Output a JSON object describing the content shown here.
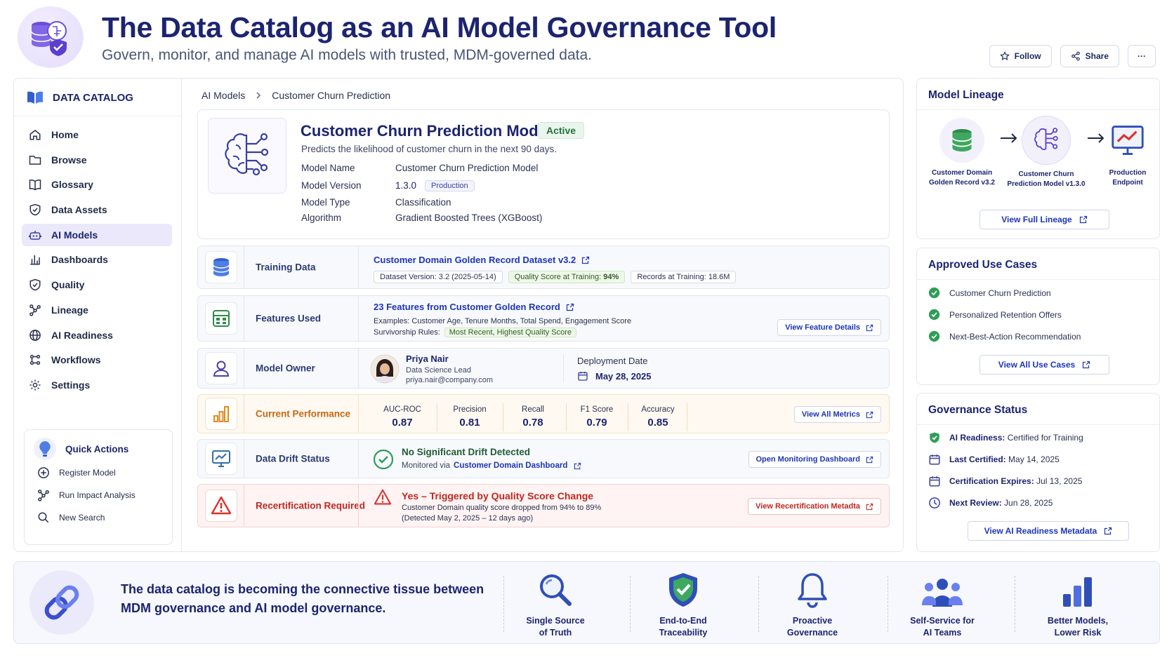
{
  "header": {
    "title": "The Data Catalog as an AI Model Governance Tool",
    "subtitle": "Govern, monitor, and manage AI models with trusted, MDM-governed data.",
    "follow_label": "Follow",
    "share_label": "Share",
    "more_label": "···"
  },
  "sidebar": {
    "brand": "DATA CATALOG",
    "items": [
      {
        "label": "Home",
        "icon": "home-icon"
      },
      {
        "label": "Browse",
        "icon": "folder-icon"
      },
      {
        "label": "Glossary",
        "icon": "book-icon"
      },
      {
        "label": "Data Assets",
        "icon": "shield-icon"
      },
      {
        "label": "AI Models",
        "icon": "robot-icon"
      },
      {
        "label": "Dashboards",
        "icon": "bar-chart-icon"
      },
      {
        "label": "Quality",
        "icon": "shield-check-icon"
      },
      {
        "label": "Lineage",
        "icon": "network-icon"
      },
      {
        "label": "AI Readiness",
        "icon": "globe-icon"
      },
      {
        "label": "Workflows",
        "icon": "workflow-icon"
      },
      {
        "label": "Settings",
        "icon": "gear-icon"
      }
    ],
    "active_index": 4,
    "quick_actions": {
      "title": "Quick Actions",
      "items": [
        "Register Model",
        "Run Impact Analysis",
        "New Search"
      ]
    }
  },
  "breadcrumb": [
    "AI Models",
    "Customer Churn Prediction"
  ],
  "model": {
    "title": "Customer Churn Prediction Model",
    "status": "Active",
    "description": "Predicts the likelihood of customer churn in the next 90 days.",
    "fields": {
      "name_label": "Model Name",
      "name_value": "Customer Churn Prediction Model",
      "version_label": "Model Version",
      "version_value": "1.3.0",
      "version_badge": "Production",
      "type_label": "Model Type",
      "type_value": "Classification",
      "algorithm_label": "Algorithm",
      "algorithm_value": "Gradient Boosted Trees (XGBoost)"
    }
  },
  "training": {
    "label": "Training Data",
    "link": "Customer Domain Golden Record Dataset v3.2",
    "tag_version": "Dataset Version: 3.2 (2025-05-14)",
    "tag_quality": "Quality Score at Training:",
    "tag_quality_value": "94%",
    "tag_records": "Records at Training: 18.6M"
  },
  "features": {
    "label": "Features Used",
    "link": "23 Features from Customer Golden Record",
    "examples": "Examples: Customer Age, Tenure Months, Total Spend, Engagement Score",
    "rules_label": "Survivorship Rules:",
    "rules_value": "Most Recent, Highest Quality Score",
    "button": "View Feature Details"
  },
  "owner": {
    "label": "Model Owner",
    "name": "Priya Nair",
    "role": "Data Science Lead",
    "email": "priya.nair@company.com",
    "deploy_label": "Deployment Date",
    "deploy_date": "May 28, 2025"
  },
  "performance": {
    "label": "Current Performance",
    "metrics": [
      {
        "name": "AUC-ROC",
        "value": "0.87"
      },
      {
        "name": "Precision",
        "value": "0.81"
      },
      {
        "name": "Recall",
        "value": "0.78"
      },
      {
        "name": "F1 Score",
        "value": "0.79"
      },
      {
        "name": "Accuracy",
        "value": "0.85"
      }
    ],
    "button": "View All Metrics"
  },
  "drift": {
    "label": "Data Drift Status",
    "status": "No Significant Drift Detected",
    "via_prefix": "Monitored via",
    "via_link": "Customer Domain Dashboard",
    "button": "Open Monitoring Dashboard"
  },
  "recert": {
    "label": "Recertification Required",
    "title": "Yes – Triggered by Quality Score Change",
    "line1": "Customer Domain quality score dropped from 94% to 89%",
    "line2": "(Detected May 2, 2025 – 12 days ago)",
    "button": "View Recertification Metadta"
  },
  "lineage": {
    "title": "Model Lineage",
    "nodes": [
      {
        "line1": "Customer Domain",
        "line2": "Golden Record v3.2"
      },
      {
        "line1": "Customer Churn",
        "line2": "Prediction Model v1.3.0"
      },
      {
        "line1": "Production",
        "line2": "Endpoint"
      }
    ],
    "button": "View Full Lineage"
  },
  "use_cases": {
    "title": "Approved Use Cases",
    "items": [
      "Customer Churn Prediction",
      "Personalized Retention Offers",
      "Next-Best-Action Recommendation"
    ],
    "button": "View All Use Cases"
  },
  "governance": {
    "title": "Governance Status",
    "items": [
      {
        "label": "AI Readiness:",
        "value": "Certified for Training"
      },
      {
        "label": "Last Certified:",
        "value": "May 14, 2025"
      },
      {
        "label": "Certification Expires:",
        "value": "Jul 13, 2025"
      },
      {
        "label": "Next Review:",
        "value": "Jun 28, 2025"
      }
    ],
    "button": "View AI Readiness Metadata"
  },
  "footer": {
    "line1": "The data catalog is becoming the connective tissue between",
    "line2": "MDM governance and AI model governance.",
    "items": [
      {
        "line1": "Single Source",
        "line2": "of Truth"
      },
      {
        "line1": "End-to-End",
        "line2": "Traceability"
      },
      {
        "line1": "Proactive",
        "line2": "Governance"
      },
      {
        "line1": "Self-Service for",
        "line2": "AI Teams"
      },
      {
        "line1": "Better Models,",
        "line2": "Lower Risk"
      }
    ]
  },
  "colors": {
    "accent": "#1c2470",
    "link": "#1c35b8",
    "success": "#2f9e57",
    "warning": "#e58a1f",
    "danger": "#d9342b",
    "active_bg": "#ebe8fb"
  }
}
